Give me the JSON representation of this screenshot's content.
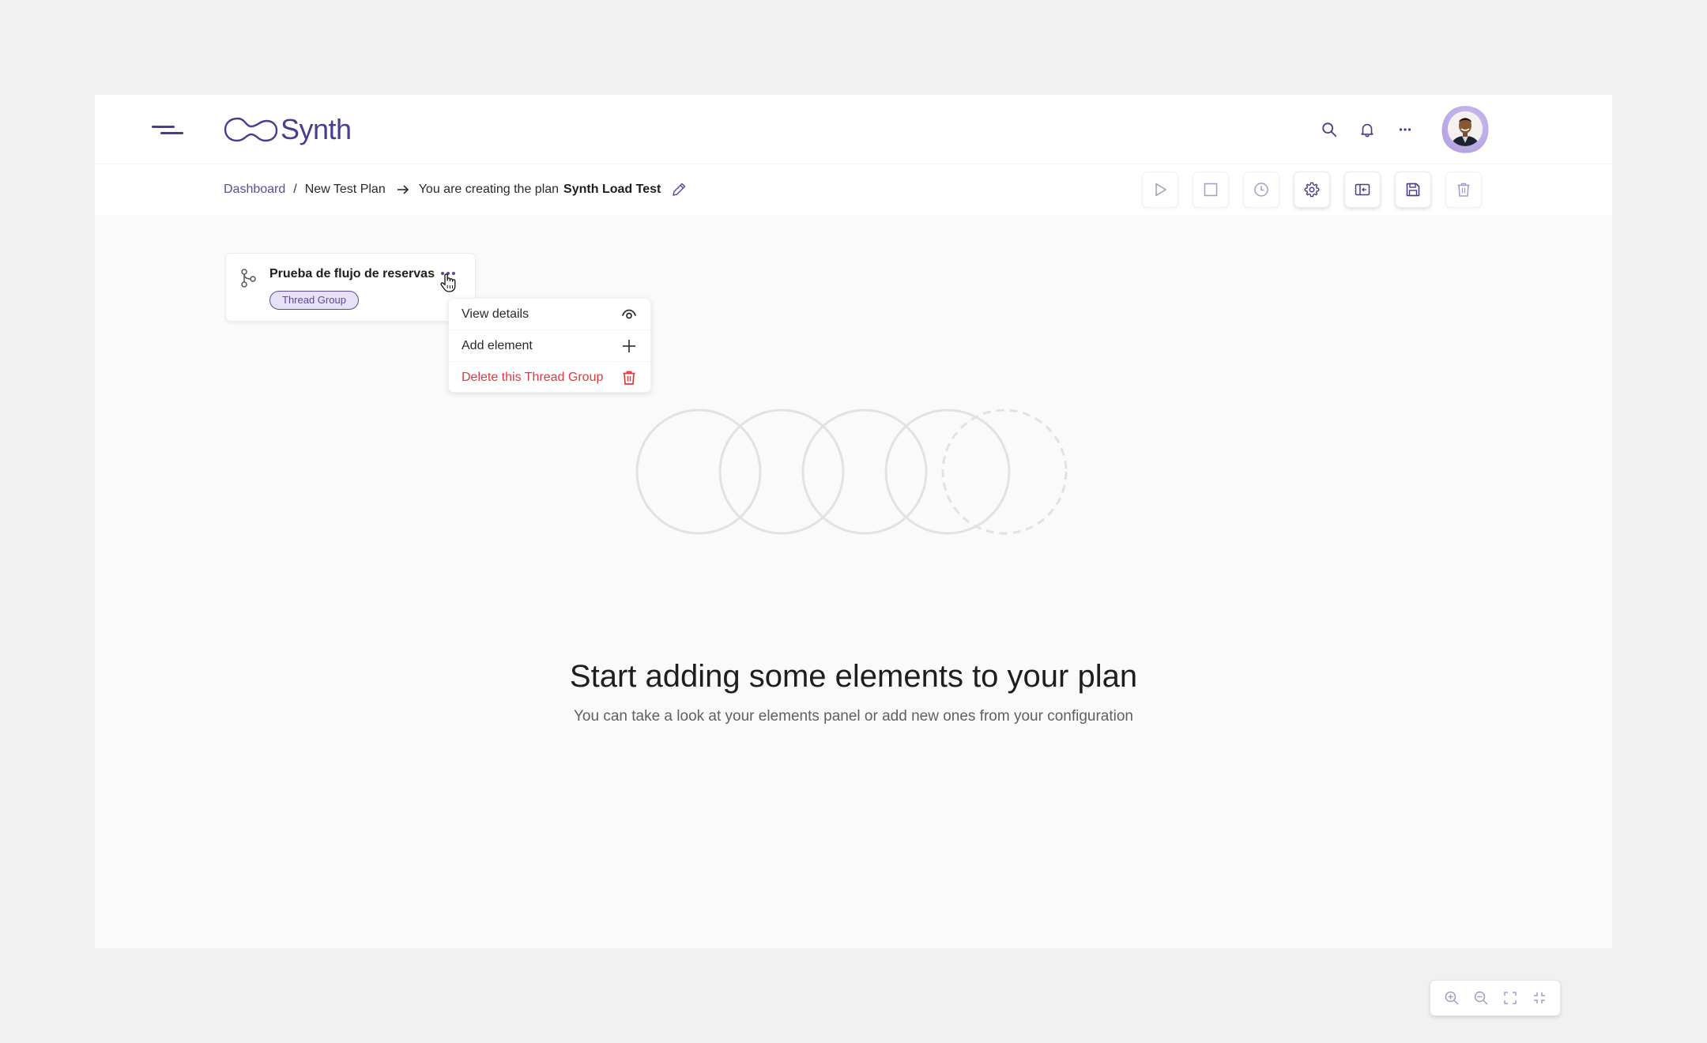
{
  "app": {
    "name": "Synth"
  },
  "colors": {
    "brand": "#4b3c8c",
    "accent_light": "#e6e1f6",
    "danger": "#e0383e",
    "text": "#1e1e1e",
    "muted": "#606060"
  },
  "header": {
    "menu_icon": "hamburger-icon",
    "logo_text": "Synth",
    "actions": [
      {
        "name": "search",
        "icon": "search-icon"
      },
      {
        "name": "notifications",
        "icon": "bell-icon"
      },
      {
        "name": "more",
        "icon": "more-horizontal-icon"
      }
    ],
    "avatar_alt": "User avatar"
  },
  "breadcrumb": {
    "items": [
      {
        "label": "Dashboard",
        "link": true
      },
      {
        "label": "New Test Plan",
        "link": false
      }
    ],
    "separator": "/",
    "creating_text": "You are creating the plan",
    "plan_name": "Synth Load Test",
    "edit_icon": "pencil-icon"
  },
  "toolbar": {
    "buttons": [
      {
        "name": "run",
        "icon": "play-icon",
        "enabled": false
      },
      {
        "name": "stop",
        "icon": "stop-icon",
        "enabled": false
      },
      {
        "name": "schedule",
        "icon": "clock-icon",
        "enabled": false
      },
      {
        "name": "settings",
        "icon": "gear-icon",
        "enabled": true
      },
      {
        "name": "toggle-panel",
        "icon": "panel-collapse-icon",
        "enabled": true
      },
      {
        "name": "save",
        "icon": "save-icon",
        "enabled": true
      },
      {
        "name": "delete",
        "icon": "trash-icon",
        "enabled": false
      }
    ]
  },
  "node": {
    "title": "Prueba de flujo de reservas",
    "badge": "Thread Group",
    "icon": "branch-icon"
  },
  "context_menu": {
    "items": [
      {
        "label": "View details",
        "icon": "eye-icon",
        "danger": false
      },
      {
        "label": "Add element",
        "icon": "plus-icon",
        "danger": false
      },
      {
        "label": "Delete this Thread Group",
        "icon": "trash-icon",
        "danger": true
      }
    ]
  },
  "empty_state": {
    "title": "Start adding some elements to your plan",
    "subtitle": "You can take a look at your elements panel or add new ones from your configuration"
  },
  "zoom_controls": [
    {
      "name": "zoom-in",
      "icon": "zoom-in-icon"
    },
    {
      "name": "zoom-out",
      "icon": "zoom-out-icon"
    },
    {
      "name": "fit-screen",
      "icon": "expand-icon"
    },
    {
      "name": "exit-fit",
      "icon": "collapse-icon"
    }
  ]
}
